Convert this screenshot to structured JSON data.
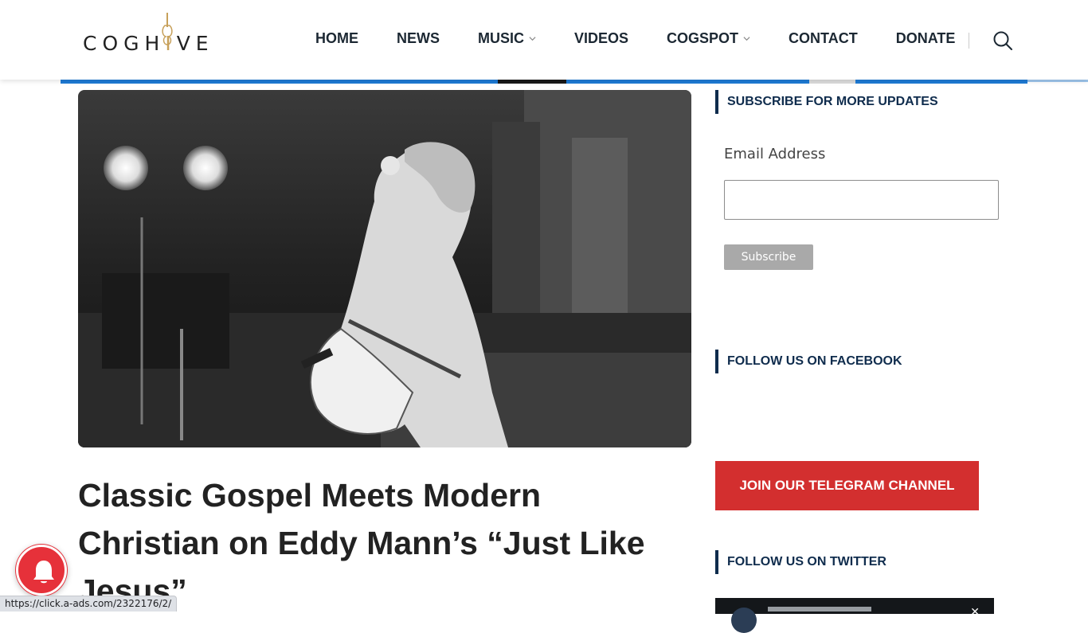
{
  "logo": {
    "prefix": "COGH",
    "accent": "I",
    "suffix": "VE"
  },
  "nav": {
    "items": [
      {
        "label": "HOME"
      },
      {
        "label": "NEWS"
      },
      {
        "label": "MUSIC"
      },
      {
        "label": "VIDEOS"
      },
      {
        "label": "COGSPOT"
      },
      {
        "label": "CONTACT"
      },
      {
        "label": "DONATE"
      }
    ],
    "search_icon": "search-icon",
    "dropdown_icon": "chevron-down-icon"
  },
  "article": {
    "title": "Classic Gospel Meets Modern Christian on Eddy Mann’s “Just Like Jesus”",
    "image_alt": "Black and white photo of a guitarist with a ponytail and glasses walking on stage holding an acoustic guitar"
  },
  "sidebar": {
    "subscribe_heading": "SUBSCRIBE FOR MORE UPDATES",
    "email_label": "Email Address",
    "email_value": "",
    "subscribe_button": "Subscribe",
    "facebook_heading": "FOLLOW US ON FACEBOOK",
    "telegram_button": "JOIN OUR TELEGRAM CHANNEL",
    "twitter_heading": "FOLLOW US ON TWITTER",
    "twitter_close": "✕"
  },
  "notification": {
    "icon": "bell-icon"
  },
  "status_bar": {
    "url": "https://click.a-ads.com/2322176/2/"
  },
  "colors": {
    "brand_blue": "#1e7bd6",
    "heading_navy": "#0f2c4d",
    "telegram_red": "#d32f2f",
    "bell_red": "#e6313a",
    "logo_gold": "#c7a05a"
  }
}
